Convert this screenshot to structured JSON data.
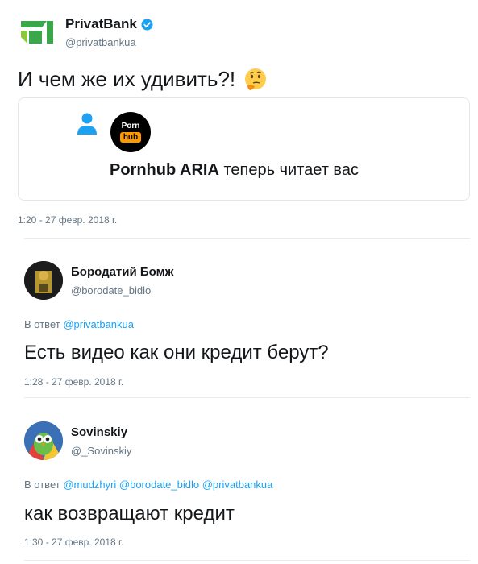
{
  "main_tweet": {
    "author_name": "PrivatBank",
    "author_handle": "@privatbankua",
    "text": "И чем же их удивить?!",
    "card": {
      "brand_top": "Porn",
      "brand_bottom": "hub",
      "title_bold": "Pornhub ARIA",
      "title_rest": "теперь читает вас"
    },
    "timestamp": "1:20 - 27 февр. 2018 г."
  },
  "replies": [
    {
      "author_name": "Бородатий Бомж",
      "author_handle": "@borodate_bidlo",
      "in_reply_prefix": "В ответ",
      "mentions": [
        "@privatbankua"
      ],
      "text": "Есть видео как они кредит берут?",
      "timestamp": "1:28 - 27 февр. 2018 г."
    },
    {
      "author_name": "Sovinskiy",
      "author_handle": "@_Sovinskiy",
      "in_reply_prefix": "В ответ",
      "mentions": [
        "@mudzhyri",
        "@borodate_bidlo",
        "@privatbankua"
      ],
      "text": "как возвращают кредит",
      "timestamp": "1:30 - 27 февр. 2018 г."
    }
  ],
  "colors": {
    "link_blue": "#1da1f2",
    "muted_gray": "#657786",
    "privatbank_green": "#3aa74a",
    "pornhub_orange": "#ff9900"
  },
  "icons": [
    "privatbank-logo",
    "verified-badge-icon",
    "thinking-face-emoji",
    "user-person-icon",
    "pornhub-logo"
  ]
}
